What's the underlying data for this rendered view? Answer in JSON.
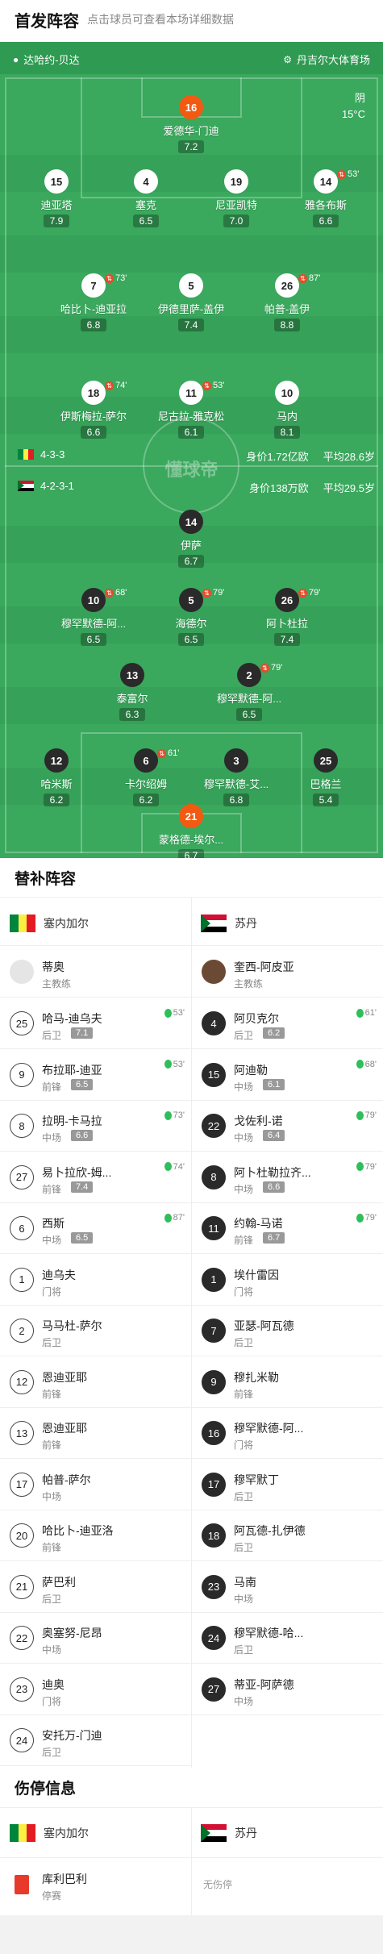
{
  "header": {
    "title": "首发阵容",
    "subtitle": "点击球员可查看本场详细数据"
  },
  "pitch": {
    "home_team": "达哈约-贝达",
    "venue": "丹吉尔大体育场",
    "weather": "阴",
    "temperature": "15°C",
    "watermark": "懂球帝",
    "home_formation": "4-3-3",
    "home_value": "身价1.72亿欧",
    "home_age": "平均28.6岁",
    "away_formation": "4-2-3-1",
    "away_value": "身价138万欧",
    "away_age": "平均29.5岁",
    "players": [
      {
        "num": "16",
        "name": "爱德华-门迪",
        "rating": "7.2",
        "style": "o",
        "ev": ""
      },
      {
        "num": "15",
        "name": "迪亚塔",
        "rating": "7.9",
        "style": "w",
        "ev": ""
      },
      {
        "num": "4",
        "name": "塞克",
        "rating": "6.5",
        "style": "w",
        "ev": ""
      },
      {
        "num": "19",
        "name": "尼亚凯特",
        "rating": "7.0",
        "style": "w",
        "ev": ""
      },
      {
        "num": "14",
        "name": "雅各布斯",
        "rating": "6.6",
        "style": "w",
        "ev": "53'"
      },
      {
        "num": "7",
        "name": "哈比卜-迪亚拉",
        "rating": "6.8",
        "style": "w",
        "ev": "73'"
      },
      {
        "num": "5",
        "name": "伊德里萨-盖伊",
        "rating": "7.4",
        "style": "w",
        "ev": ""
      },
      {
        "num": "26",
        "name": "帕普-盖伊",
        "rating": "8.8",
        "style": "w",
        "ev": "87'"
      },
      {
        "num": "18",
        "name": "伊斯梅拉-萨尔",
        "rating": "6.6",
        "style": "w",
        "ev": "74'"
      },
      {
        "num": "11",
        "name": "尼古拉-雅克松",
        "rating": "6.1",
        "style": "w",
        "ev": "53'"
      },
      {
        "num": "10",
        "name": "马内",
        "rating": "8.1",
        "style": "w",
        "ev": ""
      },
      {
        "num": "14",
        "name": "伊萨",
        "rating": "6.7",
        "style": "b",
        "ev": ""
      },
      {
        "num": "10",
        "name": "穆罕默德-阿...",
        "rating": "6.5",
        "style": "b",
        "ev": "68'"
      },
      {
        "num": "5",
        "name": "海德尔",
        "rating": "6.5",
        "style": "b",
        "ev": "79'"
      },
      {
        "num": "26",
        "name": "阿卜杜拉",
        "rating": "7.4",
        "style": "b",
        "ev": "79'"
      },
      {
        "num": "13",
        "name": "泰富尔",
        "rating": "6.3",
        "style": "b",
        "ev": ""
      },
      {
        "num": "2",
        "name": "穆罕默德-阿...",
        "rating": "6.5",
        "style": "b",
        "ev": "79'"
      },
      {
        "num": "12",
        "name": "哈米斯",
        "rating": "6.2",
        "style": "b",
        "ev": ""
      },
      {
        "num": "6",
        "name": "卡尔绍姆",
        "rating": "6.2",
        "style": "b",
        "ev": "61'"
      },
      {
        "num": "3",
        "name": "穆罕默德-艾...",
        "rating": "6.8",
        "style": "b",
        "ev": ""
      },
      {
        "num": "25",
        "name": "巴格兰",
        "rating": "5.4",
        "style": "b",
        "ev": ""
      },
      {
        "num": "21",
        "name": "蒙格德-埃尔...",
        "rating": "6.7",
        "style": "o",
        "ev": ""
      }
    ]
  },
  "subs": {
    "title": "替补阵容",
    "home_team": "塞内加尔",
    "away_team": "苏丹",
    "home_coach": {
      "name": "蒂奥",
      "role": "主教练"
    },
    "away_coach": {
      "name": "奎西-阿皮亚",
      "role": "主教练"
    },
    "home": [
      {
        "num": "25",
        "name": "哈马-迪乌夫",
        "pos": "后卫",
        "rating": "7.1",
        "ev": "53'"
      },
      {
        "num": "9",
        "name": "布拉耶-迪亚",
        "pos": "前锋",
        "rating": "6.5",
        "ev": "53'"
      },
      {
        "num": "8",
        "name": "拉明-卡马拉",
        "pos": "中场",
        "rating": "6.6",
        "ev": "73'"
      },
      {
        "num": "27",
        "name": "易卜拉欣-姆...",
        "pos": "前锋",
        "rating": "7.4",
        "ev": "74'"
      },
      {
        "num": "6",
        "name": "西斯",
        "pos": "中场",
        "rating": "6.5",
        "ev": "87'"
      },
      {
        "num": "1",
        "name": "迪乌夫",
        "pos": "门将",
        "rating": "",
        "ev": ""
      },
      {
        "num": "2",
        "name": "马马杜-萨尔",
        "pos": "后卫",
        "rating": "",
        "ev": ""
      },
      {
        "num": "12",
        "name": "恩迪亚耶",
        "pos": "前锋",
        "rating": "",
        "ev": ""
      },
      {
        "num": "13",
        "name": "恩迪亚耶",
        "pos": "前锋",
        "rating": "",
        "ev": ""
      },
      {
        "num": "17",
        "name": "帕普-萨尔",
        "pos": "中场",
        "rating": "",
        "ev": ""
      },
      {
        "num": "20",
        "name": "哈比卜-迪亚洛",
        "pos": "前锋",
        "rating": "",
        "ev": ""
      },
      {
        "num": "21",
        "name": "萨巴利",
        "pos": "后卫",
        "rating": "",
        "ev": ""
      },
      {
        "num": "22",
        "name": "奥塞努-尼昂",
        "pos": "中场",
        "rating": "",
        "ev": ""
      },
      {
        "num": "23",
        "name": "迪奥",
        "pos": "门将",
        "rating": "",
        "ev": ""
      },
      {
        "num": "24",
        "name": "安托万-门迪",
        "pos": "后卫",
        "rating": "",
        "ev": ""
      }
    ],
    "away": [
      {
        "num": "4",
        "name": "阿贝克尔",
        "pos": "后卫",
        "rating": "6.2",
        "ev": "61'"
      },
      {
        "num": "15",
        "name": "阿迪勒",
        "pos": "中场",
        "rating": "6.1",
        "ev": "68'"
      },
      {
        "num": "22",
        "name": "戈佐利-诺",
        "pos": "中场",
        "rating": "6.4",
        "ev": "79'"
      },
      {
        "num": "8",
        "name": "阿卜杜勒拉齐...",
        "pos": "中场",
        "rating": "6.6",
        "ev": "79'"
      },
      {
        "num": "11",
        "name": "约翰-马诺",
        "pos": "前锋",
        "rating": "6.7",
        "ev": "79'"
      },
      {
        "num": "1",
        "name": "埃什雷因",
        "pos": "门将",
        "rating": "",
        "ev": ""
      },
      {
        "num": "7",
        "name": "亚瑟-阿瓦德",
        "pos": "后卫",
        "rating": "",
        "ev": ""
      },
      {
        "num": "9",
        "name": "穆扎米勒",
        "pos": "前锋",
        "rating": "",
        "ev": ""
      },
      {
        "num": "16",
        "name": "穆罕默德-阿...",
        "pos": "门将",
        "rating": "",
        "ev": ""
      },
      {
        "num": "17",
        "name": "穆罕默丁",
        "pos": "后卫",
        "rating": "",
        "ev": ""
      },
      {
        "num": "18",
        "name": "阿瓦德-扎伊德",
        "pos": "后卫",
        "rating": "",
        "ev": ""
      },
      {
        "num": "23",
        "name": "马南",
        "pos": "中场",
        "rating": "",
        "ev": ""
      },
      {
        "num": "24",
        "name": "穆罕默德-哈...",
        "pos": "后卫",
        "rating": "",
        "ev": ""
      },
      {
        "num": "27",
        "name": "蒂亚-阿萨德",
        "pos": "中场",
        "rating": "",
        "ev": ""
      }
    ]
  },
  "injury": {
    "title": "伤停信息",
    "home_team": "塞内加尔",
    "away_team": "苏丹",
    "home_player": {
      "name": "库利巴利",
      "status": "停赛"
    },
    "away_none": "无伤停"
  },
  "colors": {
    "pitch": "#3aa85d",
    "accent": "#f25a12",
    "senegal_green": "#00853f",
    "senegal_yellow": "#fdef42",
    "senegal_red": "#e31b23"
  }
}
